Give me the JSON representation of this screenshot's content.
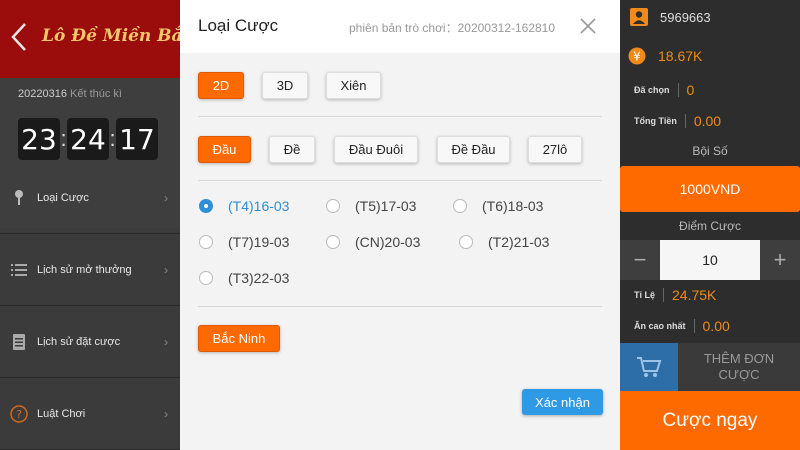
{
  "left_panel": {
    "title": "Lô Đề Miền Bắc",
    "session_id": "20220316",
    "session_status": "Kết thúc kì",
    "countdown": {
      "hours": "23",
      "minutes": "24",
      "seconds": "17"
    },
    "menu_items": [
      {
        "label": "Loại Cược",
        "icon": "pin-icon"
      },
      {
        "label": "Lịch sử mở thưởng",
        "icon": "list-icon"
      },
      {
        "label": "Lịch sử đặt cược",
        "icon": "document-icon"
      },
      {
        "label": "Luật Chơi",
        "icon": "question-icon"
      }
    ]
  },
  "modal": {
    "title": "Loại Cược",
    "version": "phiên bản trò chơi：20200312-162810",
    "mode_tabs": [
      "2D",
      "3D",
      "Xiên"
    ],
    "mode_selected": "2D",
    "type_tabs": [
      "Đầu",
      "Đề",
      "Đầu Đuôi",
      "Đề Đầu",
      "27lô"
    ],
    "type_selected": "Đầu",
    "dates": [
      "(T4)16-03",
      "(T5)17-03",
      "(T6)18-03",
      "(T7)19-03",
      "(CN)20-03",
      "(T2)21-03",
      "(T3)22-03"
    ],
    "date_selected": "(T4)16-03",
    "region": "Bắc Ninh",
    "confirm_label": "Xác nhận"
  },
  "right_panel": {
    "balance": "5969663",
    "currency_value": "18.67K",
    "selected_label": "Đã chọn",
    "selected_value": "0",
    "total_label": "Tổng Tiền",
    "total_value": "0.00",
    "multiplier_label": "Bội Số",
    "stake_value": "1000VND",
    "points_label": "Điểm Cược",
    "points_value": "10",
    "minus_label": "−",
    "plus_label": "+",
    "rate_label": "Tỉ Lệ",
    "rate_value": "24.75K",
    "max_win_label": "Ăn cao nhất",
    "max_win_value": "0.00",
    "add_order_label": "THÊM ĐƠN CƯỢC",
    "bet_now_label": "Cược ngay"
  },
  "colors": {
    "accent_orange": "#ff6a00",
    "header_red": "#9b0c0c",
    "title_gold": "#f2c76b",
    "radio_blue": "#2f8fd6",
    "confirm_blue": "#2e9ae6"
  }
}
